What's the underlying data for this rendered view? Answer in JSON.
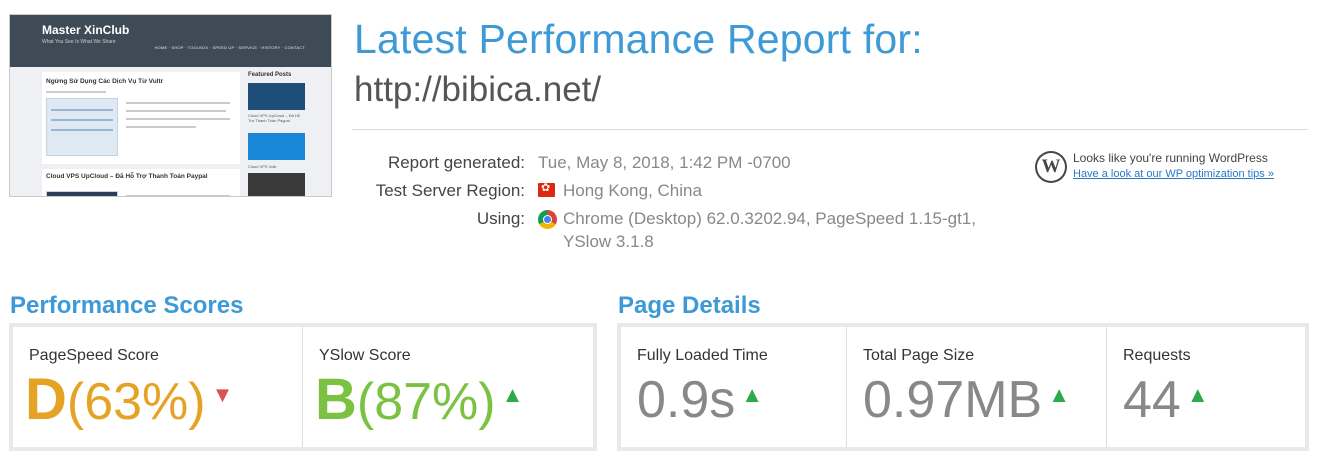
{
  "thumbnail": {
    "site_title": "Master XinClub",
    "site_tagline": "What You See Is What We Share",
    "nav": "HOME · SHOP · TOOLBOX · SPEED UP · SERVICE · HISTORY · CONTACT",
    "post1_title": "Ngừng Sử Dụng Các Dịch Vụ Từ Vultr",
    "post2_title": "Cloud VPS UpCloud – Đã Hỗ Trợ Thanh Toán Paypal",
    "sidebar_title": "Featured Posts",
    "sidebar_cap1": "Cloud VPS UpCloud – Đã Hỗ Trợ Thanh Toán Paypal",
    "sidebar_cap2": "Cloud VPS Vultr"
  },
  "header": {
    "title": "Latest Performance Report for:",
    "url": "http://bibica.net/"
  },
  "meta": {
    "generated_label": "Report generated:",
    "generated_value": "Tue, May 8, 2018, 1:42 PM -0700",
    "region_label": "Test Server Region:",
    "region_value": "Hong Kong, China",
    "using_label": "Using:",
    "using_value_line1": "Chrome (Desktop) 62.0.3202.94, PageSpeed 1.15-gt1,",
    "using_value_line2": "YSlow 3.1.8"
  },
  "wordpress": {
    "text": "Looks like you're running WordPress",
    "link": "Have a look at our WP optimization tips »"
  },
  "performance": {
    "title": "Performance Scores",
    "pagespeed": {
      "label": "PageSpeed Score",
      "grade": "D",
      "percent": "(63%)",
      "trend": "down",
      "color": "#e5a326"
    },
    "yslow": {
      "label": "YSlow Score",
      "grade": "B",
      "percent": "(87%)",
      "trend": "up",
      "color": "#7cc242"
    }
  },
  "details": {
    "title": "Page Details",
    "load_time": {
      "label": "Fully Loaded Time",
      "value": "0.9s",
      "trend": "up"
    },
    "page_size": {
      "label": "Total Page Size",
      "value": "0.97MB",
      "trend": "up"
    },
    "requests": {
      "label": "Requests",
      "value": "44",
      "trend": "up"
    }
  },
  "icons": {
    "up": "▲",
    "down": "▼"
  }
}
